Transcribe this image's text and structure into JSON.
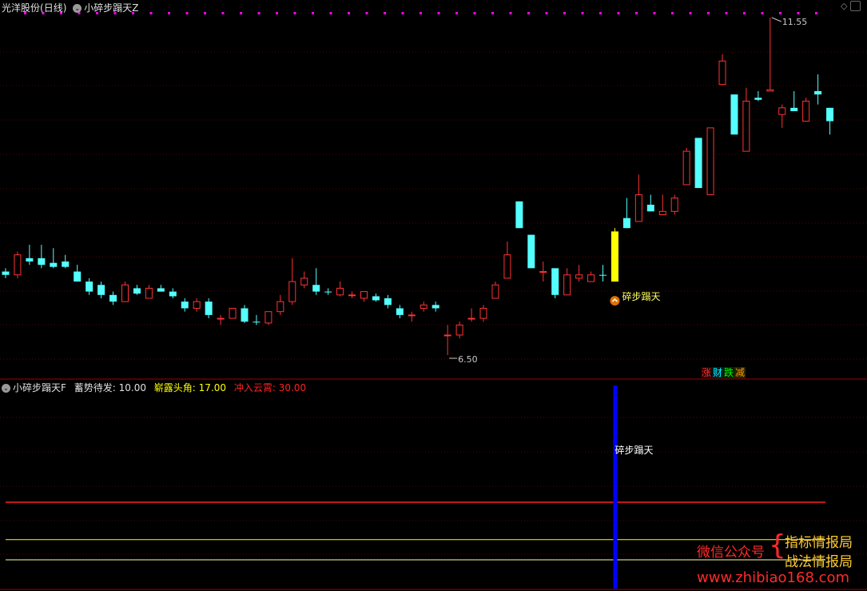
{
  "top_panel": {
    "stock_name": "光洋股份",
    "period": "(日线)",
    "indicator_name": "小碎步蹋天Z",
    "high_label": "11.55",
    "low_label": "6.50",
    "signal_label": "碎步蹋天",
    "signal_dot_colors": "#ff00ff",
    "buttons": [
      "涨",
      "财",
      "跌",
      "减"
    ],
    "button_colors": [
      "#ff3333",
      "#00ffff",
      "#00ff00",
      "#ff9900"
    ]
  },
  "bottom_panel": {
    "indicator_name": "小碎步蹋天F",
    "params": [
      {
        "label": "蓄势待发:",
        "value": "10.00",
        "color": "#e0e0e0"
      },
      {
        "label": "崭露头角:",
        "value": "17.00",
        "color": "#ffff00"
      },
      {
        "label": "冲入云霄:",
        "value": "30.00",
        "color": "#ff2020"
      }
    ],
    "signal_label": "碎步蹋天",
    "line_levels": [
      10,
      17,
      30
    ],
    "signal_bar_color": "#0000ff"
  },
  "watermark": {
    "wechat": "微信公众号",
    "brace": "{",
    "name1": "指标情报局",
    "name2": "战法情报局",
    "url": "www.zhibiao168.com"
  },
  "chart_data": {
    "type": "candlestick",
    "price_range": [
      6.5,
      11.55
    ],
    "candles": [
      {
        "o": 7.7,
        "h": 7.8,
        "l": 7.65,
        "c": 7.75,
        "up": false
      },
      {
        "o": 7.7,
        "h": 8.05,
        "l": 7.65,
        "c": 8.0,
        "up": true
      },
      {
        "o": 7.95,
        "h": 8.15,
        "l": 7.85,
        "c": 7.9,
        "up": false
      },
      {
        "o": 7.95,
        "h": 8.15,
        "l": 7.8,
        "c": 7.85,
        "up": false
      },
      {
        "o": 7.88,
        "h": 8.1,
        "l": 7.8,
        "c": 7.82,
        "up": false
      },
      {
        "o": 7.9,
        "h": 8.0,
        "l": 7.8,
        "c": 7.82,
        "up": false
      },
      {
        "o": 7.75,
        "h": 7.85,
        "l": 7.6,
        "c": 7.6,
        "up": false
      },
      {
        "o": 7.6,
        "h": 7.65,
        "l": 7.4,
        "c": 7.45,
        "up": false
      },
      {
        "o": 7.55,
        "h": 7.6,
        "l": 7.35,
        "c": 7.4,
        "up": false
      },
      {
        "o": 7.4,
        "h": 7.45,
        "l": 7.25,
        "c": 7.3,
        "up": false
      },
      {
        "o": 7.3,
        "h": 7.6,
        "l": 7.3,
        "c": 7.55,
        "up": true
      },
      {
        "o": 7.5,
        "h": 7.55,
        "l": 7.4,
        "c": 7.42,
        "up": false
      },
      {
        "o": 7.35,
        "h": 7.55,
        "l": 7.35,
        "c": 7.5,
        "up": true
      },
      {
        "o": 7.5,
        "h": 7.55,
        "l": 7.45,
        "c": 7.45,
        "up": false
      },
      {
        "o": 7.45,
        "h": 7.5,
        "l": 7.35,
        "c": 7.38,
        "up": false
      },
      {
        "o": 7.3,
        "h": 7.35,
        "l": 7.15,
        "c": 7.2,
        "up": false
      },
      {
        "o": 7.2,
        "h": 7.35,
        "l": 7.15,
        "c": 7.3,
        "up": true
      },
      {
        "o": 7.3,
        "h": 7.35,
        "l": 7.05,
        "c": 7.1,
        "up": false
      },
      {
        "o": 7.05,
        "h": 7.1,
        "l": 6.95,
        "c": 7.05,
        "up": true
      },
      {
        "o": 7.05,
        "h": 7.2,
        "l": 7.05,
        "c": 7.2,
        "up": true
      },
      {
        "o": 7.2,
        "h": 7.25,
        "l": 6.98,
        "c": 7.0,
        "up": false
      },
      {
        "o": 7.0,
        "h": 7.1,
        "l": 6.95,
        "c": 7.0,
        "up": false
      },
      {
        "o": 6.98,
        "h": 7.15,
        "l": 6.95,
        "c": 7.15,
        "up": true
      },
      {
        "o": 7.15,
        "h": 7.4,
        "l": 7.1,
        "c": 7.3,
        "up": true
      },
      {
        "o": 7.3,
        "h": 7.95,
        "l": 7.25,
        "c": 7.6,
        "up": true
      },
      {
        "o": 7.55,
        "h": 7.75,
        "l": 7.5,
        "c": 7.65,
        "up": true
      },
      {
        "o": 7.55,
        "h": 7.8,
        "l": 7.4,
        "c": 7.45,
        "up": false
      },
      {
        "o": 7.45,
        "h": 7.5,
        "l": 7.4,
        "c": 7.45,
        "up": false
      },
      {
        "o": 7.4,
        "h": 7.6,
        "l": 7.38,
        "c": 7.5,
        "up": true
      },
      {
        "o": 7.4,
        "h": 7.45,
        "l": 7.35,
        "c": 7.4,
        "up": true
      },
      {
        "o": 7.35,
        "h": 7.45,
        "l": 7.3,
        "c": 7.45,
        "up": true
      },
      {
        "o": 7.38,
        "h": 7.42,
        "l": 7.3,
        "c": 7.32,
        "up": false
      },
      {
        "o": 7.35,
        "h": 7.4,
        "l": 7.2,
        "c": 7.25,
        "up": false
      },
      {
        "o": 7.2,
        "h": 7.25,
        "l": 7.05,
        "c": 7.1,
        "up": false
      },
      {
        "o": 7.1,
        "h": 7.15,
        "l": 7.0,
        "c": 7.1,
        "up": true
      },
      {
        "o": 7.2,
        "h": 7.3,
        "l": 7.15,
        "c": 7.25,
        "up": true
      },
      {
        "o": 7.25,
        "h": 7.3,
        "l": 7.15,
        "c": 7.2,
        "up": false
      },
      {
        "o": 6.8,
        "h": 6.95,
        "l": 6.5,
        "c": 6.8,
        "up": true
      },
      {
        "o": 6.8,
        "h": 7.0,
        "l": 6.75,
        "c": 6.95,
        "up": true
      },
      {
        "o": 7.05,
        "h": 7.2,
        "l": 7.0,
        "c": 7.05,
        "up": true
      },
      {
        "o": 7.05,
        "h": 7.25,
        "l": 7.0,
        "c": 7.2,
        "up": true
      },
      {
        "o": 7.35,
        "h": 7.6,
        "l": 7.35,
        "c": 7.55,
        "up": true
      },
      {
        "o": 7.65,
        "h": 8.2,
        "l": 7.65,
        "c": 8.0,
        "up": true
      },
      {
        "o": 8.8,
        "h": 8.8,
        "l": 8.4,
        "c": 8.4,
        "up": false
      },
      {
        "o": 8.3,
        "h": 8.3,
        "l": 7.8,
        "c": 7.8,
        "up": false
      },
      {
        "o": 7.75,
        "h": 7.9,
        "l": 7.6,
        "c": 7.75,
        "up": true
      },
      {
        "o": 7.8,
        "h": 7.8,
        "l": 7.35,
        "c": 7.4,
        "up": false
      },
      {
        "o": 7.4,
        "h": 7.8,
        "l": 7.4,
        "c": 7.7,
        "up": true
      },
      {
        "o": 7.65,
        "h": 7.85,
        "l": 7.6,
        "c": 7.7,
        "up": true
      },
      {
        "o": 7.6,
        "h": 7.75,
        "l": 7.6,
        "c": 7.7,
        "up": true
      },
      {
        "o": 7.7,
        "h": 7.85,
        "l": 7.6,
        "c": 7.7,
        "up": false
      },
      {
        "o": 7.6,
        "h": 8.4,
        "l": 7.6,
        "c": 8.35,
        "up": true
      },
      {
        "o": 8.55,
        "h": 8.85,
        "l": 8.4,
        "c": 8.4,
        "up": false
      },
      {
        "o": 8.5,
        "h": 9.2,
        "l": 8.5,
        "c": 8.9,
        "up": true
      },
      {
        "o": 8.75,
        "h": 8.9,
        "l": 8.65,
        "c": 8.65,
        "up": false
      },
      {
        "o": 8.6,
        "h": 8.9,
        "l": 8.6,
        "c": 8.65,
        "up": true
      },
      {
        "o": 8.65,
        "h": 8.9,
        "l": 8.6,
        "c": 8.85,
        "up": true
      },
      {
        "o": 9.05,
        "h": 9.6,
        "l": 9.05,
        "c": 9.55,
        "up": true
      },
      {
        "o": 9.75,
        "h": 9.75,
        "l": 9.0,
        "c": 9.0,
        "up": false
      },
      {
        "o": 8.9,
        "h": 9.9,
        "l": 8.9,
        "c": 9.9,
        "up": true
      },
      {
        "o": 10.55,
        "h": 11.0,
        "l": 10.55,
        "c": 10.9,
        "up": true
      },
      {
        "o": 10.4,
        "h": 10.4,
        "l": 9.8,
        "c": 9.8,
        "up": false
      },
      {
        "o": 9.55,
        "h": 10.5,
        "l": 9.55,
        "c": 10.3,
        "up": true
      },
      {
        "o": 10.35,
        "h": 10.45,
        "l": 10.3,
        "c": 10.32,
        "up": false
      },
      {
        "o": 10.45,
        "h": 11.55,
        "l": 10.45,
        "c": 10.47,
        "up": true
      },
      {
        "o": 10.1,
        "h": 10.25,
        "l": 9.9,
        "c": 10.2,
        "up": true
      },
      {
        "o": 10.2,
        "h": 10.45,
        "l": 10.15,
        "c": 10.15,
        "up": false
      },
      {
        "o": 10.0,
        "h": 10.35,
        "l": 10.0,
        "c": 10.3,
        "up": true
      },
      {
        "o": 10.45,
        "h": 10.7,
        "l": 10.25,
        "c": 10.4,
        "up": false
      },
      {
        "o": 10.2,
        "h": 10.2,
        "l": 9.8,
        "c": 10.0,
        "up": false
      }
    ],
    "signal_candle_index": 51,
    "signal_bar_value": 30
  }
}
